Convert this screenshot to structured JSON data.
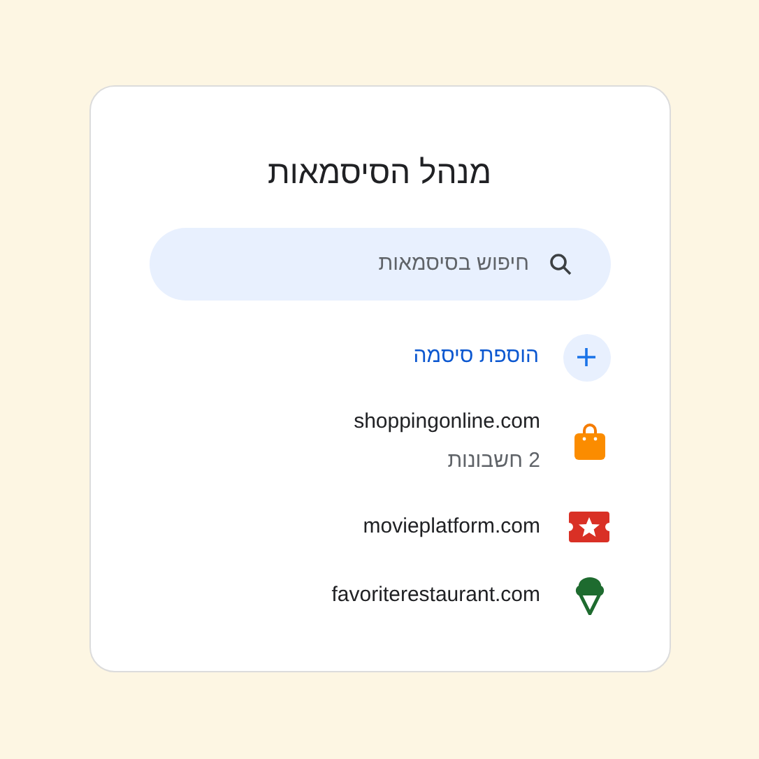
{
  "title": "מנהל הסיסמאות",
  "search": {
    "placeholder": "חיפוש בסיסמאות"
  },
  "add_button": {
    "label": "הוספת סיסמה"
  },
  "sites": [
    {
      "kind": "bag",
      "name": "shoppingonline.com",
      "subtitle": "2 חשבונות"
    },
    {
      "kind": "ticket",
      "name": "movieplatform.com"
    },
    {
      "kind": "icecream",
      "name": "favoriterestaurant.com"
    }
  ]
}
